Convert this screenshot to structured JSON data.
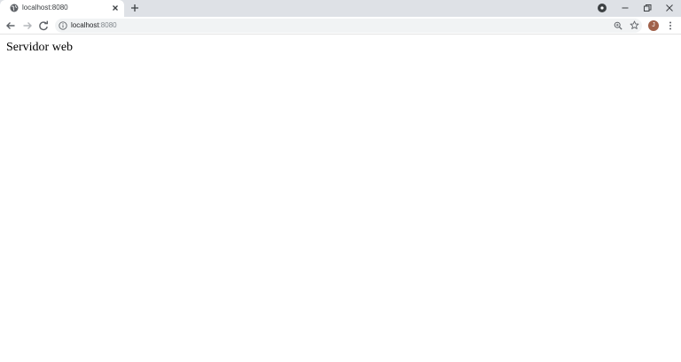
{
  "browser": {
    "tab": {
      "title": "localhost:8080"
    },
    "address_bar": {
      "host": "localhost",
      "port": ":8080"
    },
    "profile_initial": "J"
  },
  "page": {
    "text": "Servidor web"
  },
  "icons": {
    "favicon": "globe-icon",
    "tab_close": "close-icon",
    "new_tab": "plus-icon",
    "media": "media-control-icon",
    "minimize": "minimize-icon",
    "restore": "restore-icon",
    "close": "close-icon",
    "back": "arrow-left-icon",
    "forward": "arrow-right-icon",
    "reload": "reload-icon",
    "info": "info-icon",
    "zoom": "zoom-icon",
    "bookmark": "star-icon",
    "menu": "kebab-menu-icon"
  },
  "colors": {
    "tabstrip": "#dee1e6",
    "omnibox": "#f1f3f4",
    "avatar": "#a0614a"
  }
}
